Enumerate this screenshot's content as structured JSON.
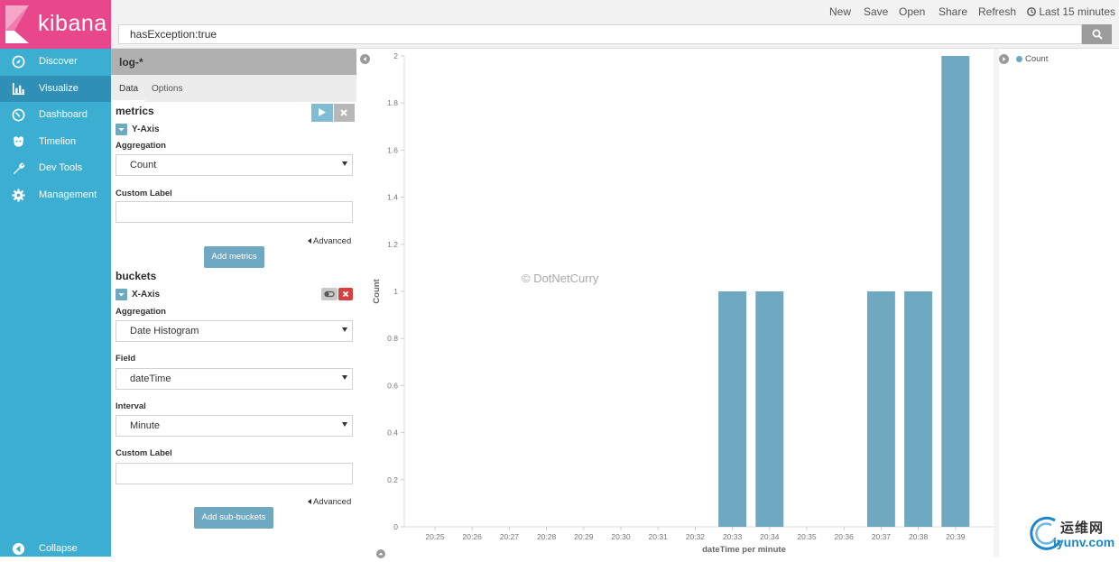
{
  "app": {
    "logo_text": "kibana"
  },
  "sidebar": {
    "items": [
      {
        "label": "Discover",
        "icon": "compass-icon"
      },
      {
        "label": "Visualize",
        "icon": "bar-chart-icon",
        "active": true
      },
      {
        "label": "Dashboard",
        "icon": "dashboard-icon"
      },
      {
        "label": "Timelion",
        "icon": "timelion-icon"
      },
      {
        "label": "Dev Tools",
        "icon": "wrench-icon"
      },
      {
        "label": "Management",
        "icon": "gear-icon"
      }
    ],
    "collapse_label": "Collapse"
  },
  "topbar": {
    "menu": [
      "New",
      "Save",
      "Open",
      "Share",
      "Refresh"
    ],
    "time_range": "Last 15 minutes",
    "query": "hasException:true"
  },
  "editor": {
    "index_pattern": "log-*",
    "tabs": [
      "Data",
      "Options"
    ],
    "metrics": {
      "title": "metrics",
      "agg_name": "Y-Axis",
      "aggregation_label": "Aggregation",
      "aggregation_value": "Count",
      "custom_label_label": "Custom Label",
      "custom_label_value": "",
      "advanced_label": "Advanced",
      "add_button": "Add metrics"
    },
    "buckets": {
      "title": "buckets",
      "agg_name": "X-Axis",
      "aggregation_label": "Aggregation",
      "aggregation_value": "Date Histogram",
      "field_label": "Field",
      "field_value": "dateTime",
      "interval_label": "Interval",
      "interval_value": "Minute",
      "custom_label_label": "Custom Label",
      "custom_label_value": "",
      "advanced_label": "Advanced",
      "add_button": "Add sub-buckets"
    }
  },
  "watermark": "© DotNetCurry",
  "brand": {
    "top": "运维网",
    "bottom": "iyunv.com"
  },
  "colors": {
    "accent": "#6fa9c1",
    "sidebar": "#3caed2",
    "logo": "#e8488b"
  },
  "chart_data": {
    "type": "bar",
    "xlabel": "dateTime per minute",
    "ylabel": "Count",
    "categories": [
      "20:25",
      "20:26",
      "20:27",
      "20:28",
      "20:29",
      "20:30",
      "20:31",
      "20:32",
      "20:33",
      "20:34",
      "20:35",
      "20:36",
      "20:37",
      "20:38",
      "20:39"
    ],
    "series": [
      {
        "name": "Count",
        "values": [
          0,
          0,
          0,
          0,
          0,
          0,
          0,
          0,
          1,
          1,
          0,
          0,
          1,
          1,
          2
        ]
      }
    ],
    "yticks": [
      "0",
      "0.2",
      "0.4",
      "0.6",
      "0.8",
      "1",
      "1.2",
      "1.4",
      "1.6",
      "1.8",
      "2"
    ],
    "ylim": [
      0,
      2
    ],
    "grid": false,
    "legend": "top-right"
  }
}
